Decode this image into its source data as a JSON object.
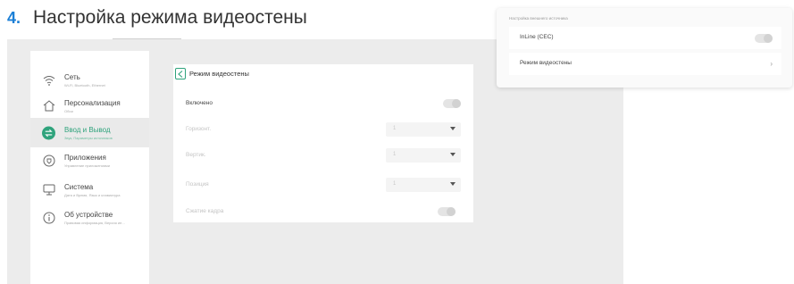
{
  "doc": {
    "step_number": "4.",
    "heading": "Настройка режима видеостены"
  },
  "sidebar": {
    "items": [
      {
        "label": "Сеть",
        "sub": "Wi-Fi, Bluetooth, Ethernet",
        "icon": "wifi-icon"
      },
      {
        "label": "Персонализация",
        "sub": "Обои",
        "icon": "home-icon"
      },
      {
        "label": "Ввод и Вывод",
        "sub": "Звук, Параметры источников",
        "icon": "swap-icon",
        "active": true
      },
      {
        "label": "Приложения",
        "sub": "Управление приложениями",
        "icon": "shield-icon"
      },
      {
        "label": "Система",
        "sub": "Дата и Время, Язык и клавиатура",
        "icon": "monitor-icon"
      },
      {
        "label": "Об устройстве",
        "sub": "Правовая информация, Версия ие...",
        "icon": "info-icon"
      }
    ]
  },
  "panel": {
    "title": "Режим видеостены",
    "enabled_label": "Включено",
    "horizontal_label": "Горизонт.",
    "horizontal_value": "1",
    "vertical_label": "Вертик.",
    "vertical_value": "1",
    "position_label": "Позиция",
    "position_value": "1",
    "frame_comp_label": "Сжатие кадра"
  },
  "popup": {
    "caption": "Настройка внешнего источника",
    "inline_label": "InLine (CEC)",
    "videowall_label": "Режим видеостены",
    "chevron": "›"
  },
  "colors": {
    "accent": "#2fa37c",
    "heading_number": "#1b7fd6",
    "screen_bg": "#ececec"
  }
}
